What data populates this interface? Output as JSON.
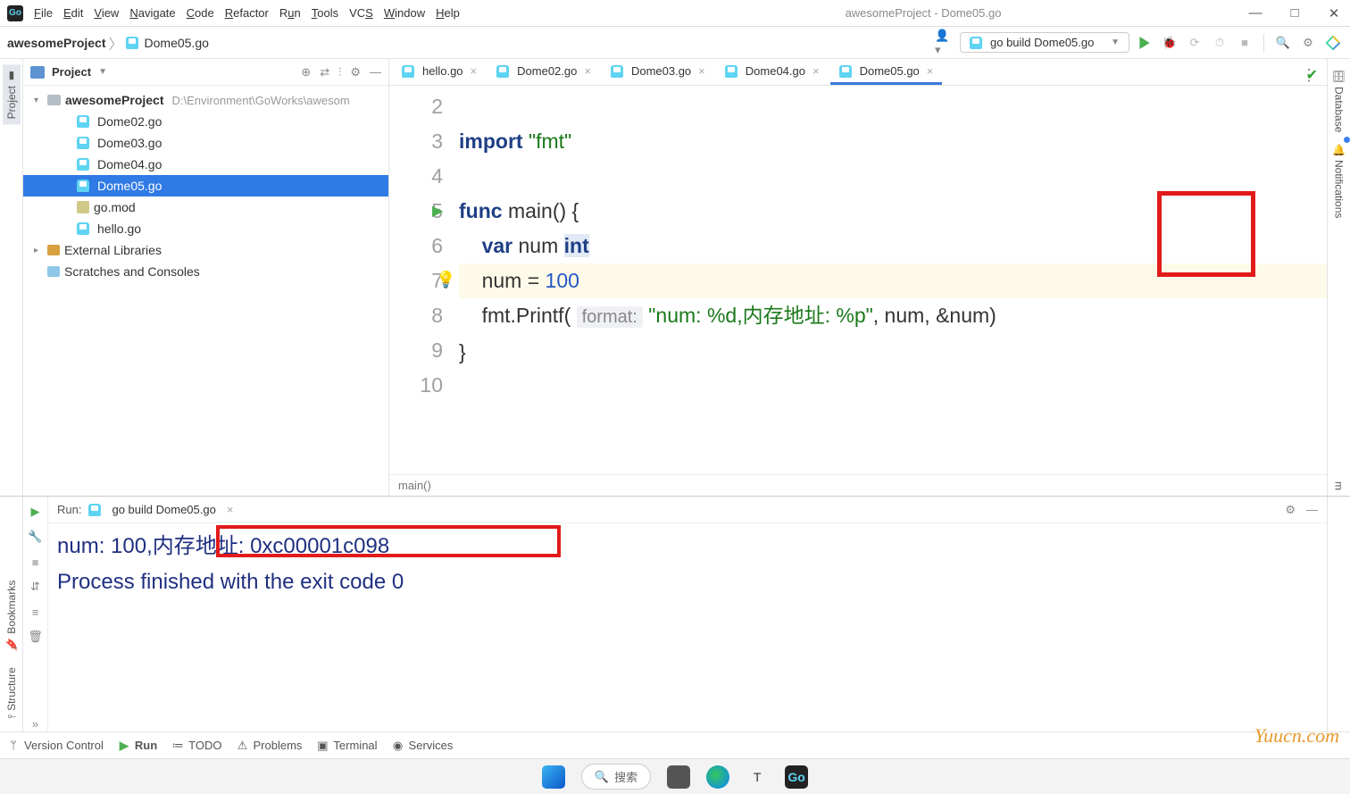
{
  "title": "awesomeProject - Dome05.go",
  "menu": [
    "File",
    "Edit",
    "View",
    "Navigate",
    "Code",
    "Refactor",
    "Run",
    "Tools",
    "VCS",
    "Window",
    "Help"
  ],
  "breadcrumb": {
    "project": "awesomeProject",
    "file": "Dome05.go"
  },
  "run_config": "go build Dome05.go",
  "project_panel": {
    "label": "Project",
    "root": "awesomeProject",
    "root_path": "D:\\Environment\\GoWorks\\awesom",
    "files": [
      "Dome02.go",
      "Dome03.go",
      "Dome04.go",
      "Dome05.go",
      "go.mod",
      "hello.go"
    ],
    "selected": "Dome05.go",
    "external": "External Libraries",
    "scratches": "Scratches and Consoles"
  },
  "editor_tabs": [
    "hello.go",
    "Dome02.go",
    "Dome03.go",
    "Dome04.go",
    "Dome05.go"
  ],
  "editor_active": "Dome05.go",
  "code": {
    "line_start": 2,
    "import_kw": "import",
    "import_pkg": "\"fmt\"",
    "func_kw": "func",
    "main_name": "main",
    "open": "() {",
    "var_kw": "var",
    "var_name": "num",
    "var_type": "int",
    "assign": "num = ",
    "assign_val": "100",
    "fmt_call": "fmt.Printf(",
    "hint": "format:",
    "str": " \"num: %d,内存地址: %p\"",
    "args": ", num, ",
    "amp": "&num)",
    "close": "}",
    "breadcrumb": "main()"
  },
  "run_panel": {
    "label": "Run:",
    "tab": "go build Dome05.go",
    "out1_a": "num: 100,",
    "out1_b": "内存地址: 0xc00001c098",
    "out2": "Process finished with the exit code 0"
  },
  "bottom": [
    "Version Control",
    "Run",
    "TODO",
    "Problems",
    "Terminal",
    "Services"
  ],
  "right_tabs": [
    "Database",
    "Notifications"
  ],
  "right_tab_m": "m",
  "left_tabs": {
    "project": "Project",
    "bookmarks": "Bookmarks",
    "structure": "Structure"
  },
  "taskbar": {
    "search": "搜索"
  },
  "watermark": "Yuucn.com"
}
